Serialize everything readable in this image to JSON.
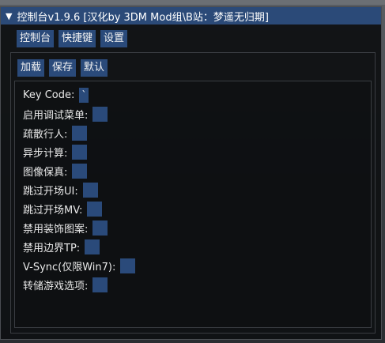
{
  "window": {
    "title": "控制台v1.9.6 [汉化by 3DM Mod组\\B站：梦遥无归期]"
  },
  "menu": [
    {
      "label": "控制台"
    },
    {
      "label": "快捷键"
    },
    {
      "label": "设置"
    }
  ],
  "toolbar": [
    {
      "label": "加载"
    },
    {
      "label": "保存"
    },
    {
      "label": "默认"
    }
  ],
  "settings": [
    {
      "label": "Key Code:",
      "value": "`"
    },
    {
      "label": "启用调试菜单:",
      "value": ""
    },
    {
      "label": "疏散行人:",
      "value": ""
    },
    {
      "label": "异步计算:",
      "value": ""
    },
    {
      "label": "图像保真:",
      "value": ""
    },
    {
      "label": "跳过开场UI:",
      "value": ""
    },
    {
      "label": "跳过开场MV:",
      "value": ""
    },
    {
      "label": "禁用装饰图案:",
      "value": ""
    },
    {
      "label": "禁用边界TP:",
      "value": ""
    },
    {
      "label": "V-Sync(仅限Win7):",
      "value": ""
    },
    {
      "label": "转储游戏选项:",
      "value": ""
    }
  ],
  "colors": {
    "titlebar": "#2b4a78",
    "button": "#2a4a7a",
    "panel": "#101214"
  }
}
